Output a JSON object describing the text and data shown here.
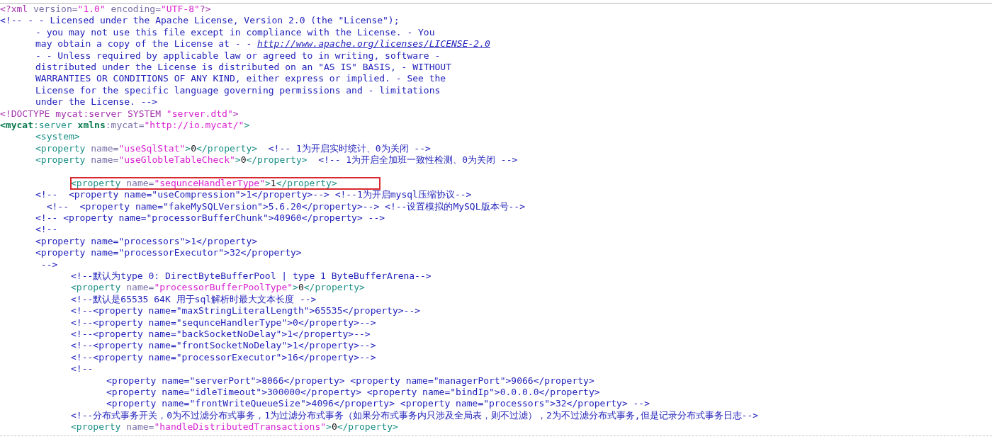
{
  "lines": [
    {
      "kind": "code",
      "highlighted": false,
      "segments": [
        {
          "kind": "pi",
          "text": "<?xml"
        },
        {
          "kind": "attr",
          "text": " version="
        },
        {
          "kind": "value",
          "text": "\"1.0\""
        },
        {
          "kind": "attr",
          "text": " encoding="
        },
        {
          "kind": "value",
          "text": "\"UTF-8\""
        },
        {
          "kind": "pi",
          "text": "?>"
        }
      ]
    },
    {
      "kind": "code",
      "highlighted": false,
      "segments": [
        {
          "kind": "comment",
          "text": "<!-- - - Licensed under the Apache License, Version 2.0 (the \"License\");"
        }
      ],
      "children": [
        {
          "kind": "code",
          "highlighted": false,
          "segments": [
            {
              "kind": "comment",
              "text": "- you may not use this file except in compliance with the License. - You"
            }
          ]
        },
        {
          "kind": "code",
          "highlighted": false,
          "segments": [
            {
              "kind": "comment",
              "text": "may obtain a copy of the License at - - "
            },
            {
              "kind": "link",
              "text": "http://www.apache.org/licenses/LICENSE-2.0"
            }
          ]
        },
        {
          "kind": "code",
          "highlighted": false,
          "segments": [
            {
              "kind": "comment",
              "text": "- - Unless required by applicable law or agreed to in writing, software -"
            }
          ]
        },
        {
          "kind": "code",
          "highlighted": false,
          "segments": [
            {
              "kind": "comment",
              "text": "distributed under the License is distributed on an \"AS IS\" BASIS, - WITHOUT"
            }
          ]
        },
        {
          "kind": "code",
          "highlighted": false,
          "segments": [
            {
              "kind": "comment",
              "text": "WARRANTIES OR CONDITIONS OF ANY KIND, either express or implied. - See the"
            }
          ]
        },
        {
          "kind": "code",
          "highlighted": false,
          "segments": [
            {
              "kind": "comment",
              "text": "License for the specific language governing permissions and - limitations"
            }
          ]
        },
        {
          "kind": "code",
          "highlighted": false,
          "segments": [
            {
              "kind": "comment",
              "text": "under the License. -->"
            }
          ]
        }
      ]
    },
    {
      "kind": "code",
      "highlighted": false,
      "segments": [
        {
          "kind": "doctype",
          "text": "<!DOCTYPE mycat:server SYSTEM "
        },
        {
          "kind": "value",
          "text": "\"server.dtd\""
        },
        {
          "kind": "doctype",
          "text": ">"
        }
      ]
    },
    {
      "kind": "code",
      "highlighted": false,
      "segments": [
        {
          "kind": "ns",
          "text": "<mycat"
        },
        {
          "kind": "tag",
          "text": ":server"
        },
        {
          "kind": "ns",
          "text": " xmlns"
        },
        {
          "kind": "attr",
          "text": ":mycat="
        },
        {
          "kind": "value",
          "text": "\"http://io.mycat/\""
        },
        {
          "kind": "tag",
          "text": ">"
        }
      ],
      "children": [
        {
          "kind": "code",
          "highlighted": false,
          "segments": [
            {
              "kind": "tag",
              "text": "<system>"
            }
          ]
        },
        {
          "kind": "code",
          "highlighted": false,
          "segments": [
            {
              "kind": "tag",
              "text": "<property"
            },
            {
              "kind": "attr",
              "text": " name="
            },
            {
              "kind": "value",
              "text": "\"useSqlStat\""
            },
            {
              "kind": "tag",
              "text": ">"
            },
            {
              "kind": "text",
              "text": "0"
            },
            {
              "kind": "tag",
              "text": "</property>"
            },
            {
              "kind": "comment",
              "text": "  <!-- 1为开启实时统计、0为关闭 -->"
            }
          ]
        },
        {
          "kind": "code",
          "highlighted": false,
          "segments": [
            {
              "kind": "tag",
              "text": "<property"
            },
            {
              "kind": "attr",
              "text": " name="
            },
            {
              "kind": "value",
              "text": "\"useGlobleTableCheck\""
            },
            {
              "kind": "tag",
              "text": ">"
            },
            {
              "kind": "text",
              "text": "0"
            },
            {
              "kind": "tag",
              "text": "</property>"
            },
            {
              "kind": "comment",
              "text": "  <!-- 1为开启全加班一致性检测、0为关闭 -->"
            }
          ]
        },
        {
          "kind": "blank",
          "children": [
            {
              "kind": "code",
              "highlighted": true,
              "segments": [
                {
                  "kind": "tag",
                  "text": "<property"
                },
                {
                  "kind": "attr",
                  "text": " name="
                },
                {
                  "kind": "value",
                  "text": "\"sequnceHandlerType\""
                },
                {
                  "kind": "tag",
                  "text": ">"
                },
                {
                  "kind": "text",
                  "text": "1"
                },
                {
                  "kind": "tag",
                  "text": "</property>"
                }
              ]
            }
          ]
        },
        {
          "kind": "code",
          "highlighted": false,
          "segments": [
            {
              "kind": "comment",
              "text": "<!--  <property name=\"useCompression\">1</property>--> <!--1为开启mysql压缩协议-->"
            }
          ]
        },
        {
          "kind": "code",
          "highlighted": false,
          "segments": [
            {
              "kind": "comment",
              "text": "  <!--  <property name=\"fakeMySQLVersion\">5.6.20</property>--> <!--设置模拟的MySQL版本号-->"
            }
          ]
        },
        {
          "kind": "code",
          "highlighted": false,
          "segments": [
            {
              "kind": "comment",
              "text": "<!-- <property name=\"processorBufferChunk\">40960</property> -->"
            }
          ]
        },
        {
          "kind": "code",
          "highlighted": false,
          "segments": [
            {
              "kind": "comment",
              "text": "<!--"
            }
          ]
        },
        {
          "kind": "code",
          "highlighted": false,
          "segments": [
            {
              "kind": "comment",
              "text": "<property name=\"processors\">1</property>"
            }
          ]
        },
        {
          "kind": "code",
          "highlighted": false,
          "segments": [
            {
              "kind": "comment",
              "text": "<property name=\"processorExecutor\">32</property>"
            }
          ]
        },
        {
          "kind": "code",
          "highlighted": false,
          "segments": [
            {
              "kind": "comment",
              "text": " -->"
            }
          ],
          "children": [
            {
              "kind": "code",
              "highlighted": false,
              "segments": [
                {
                  "kind": "comment",
                  "text": "<!--默认为type 0: DirectByteBufferPool | type 1 ByteBufferArena-->"
                }
              ]
            },
            {
              "kind": "code",
              "highlighted": false,
              "segments": [
                {
                  "kind": "tag",
                  "text": "<property"
                },
                {
                  "kind": "attr",
                  "text": " name="
                },
                {
                  "kind": "value",
                  "text": "\"processorBufferPoolType\""
                },
                {
                  "kind": "tag",
                  "text": ">"
                },
                {
                  "kind": "text",
                  "text": "0"
                },
                {
                  "kind": "tag",
                  "text": "</property>"
                }
              ]
            },
            {
              "kind": "code",
              "highlighted": false,
              "segments": [
                {
                  "kind": "comment",
                  "text": "<!--默认是65535 64K 用于sql解析时最大文本长度 -->"
                }
              ]
            },
            {
              "kind": "code",
              "highlighted": false,
              "segments": [
                {
                  "kind": "comment",
                  "text": "<!--<property name=\"maxStringLiteralLength\">65535</property>-->"
                }
              ]
            },
            {
              "kind": "code",
              "highlighted": false,
              "segments": [
                {
                  "kind": "comment",
                  "text": "<!--<property name=\"sequnceHandlerType\">0</property>-->"
                }
              ]
            },
            {
              "kind": "code",
              "highlighted": false,
              "segments": [
                {
                  "kind": "comment",
                  "text": "<!--<property name=\"backSocketNoDelay\">1</property>-->"
                }
              ]
            },
            {
              "kind": "code",
              "highlighted": false,
              "segments": [
                {
                  "kind": "comment",
                  "text": "<!--<property name=\"frontSocketNoDelay\">1</property>-->"
                }
              ]
            },
            {
              "kind": "code",
              "highlighted": false,
              "segments": [
                {
                  "kind": "comment",
                  "text": "<!--<property name=\"processorExecutor\">16</property>-->"
                }
              ]
            },
            {
              "kind": "code",
              "highlighted": false,
              "segments": [
                {
                  "kind": "comment",
                  "text": "<!--"
                }
              ],
              "children": [
                {
                  "kind": "code",
                  "highlighted": false,
                  "segments": [
                    {
                      "kind": "comment",
                      "text": "<property name=\"serverPort\">8066</property> <property name=\"managerPort\">9066</property>"
                    }
                  ]
                },
                {
                  "kind": "code",
                  "highlighted": false,
                  "segments": [
                    {
                      "kind": "comment",
                      "text": "<property name=\"idleTimeout\">300000</property> <property name=\"bindIp\">0.0.0.0</property>"
                    }
                  ]
                },
                {
                  "kind": "code",
                  "highlighted": false,
                  "segments": [
                    {
                      "kind": "comment",
                      "text": "<property name=\"frontWriteQueueSize\">4096</property> <property name=\"processors\">32</property> -->"
                    }
                  ]
                }
              ]
            },
            {
              "kind": "code",
              "highlighted": false,
              "segments": [
                {
                  "kind": "comment",
                  "text": "<!--分布式事务开关，0为不过滤分布式事务，1为过滤分布式事务（如果分布式事务内只涉及全局表，则不过滤），2为不过滤分布式事务,但是记录分布式事务日志-->"
                }
              ]
            },
            {
              "kind": "code",
              "highlighted": false,
              "segments": [
                {
                  "kind": "tag",
                  "text": "<property"
                },
                {
                  "kind": "attr",
                  "text": " name="
                },
                {
                  "kind": "value",
                  "text": "\"handleDistributedTransactions\""
                },
                {
                  "kind": "tag",
                  "text": ">"
                },
                {
                  "kind": "text",
                  "text": "0"
                },
                {
                  "kind": "tag",
                  "text": "</property>"
                }
              ]
            }
          ]
        }
      ]
    }
  ]
}
